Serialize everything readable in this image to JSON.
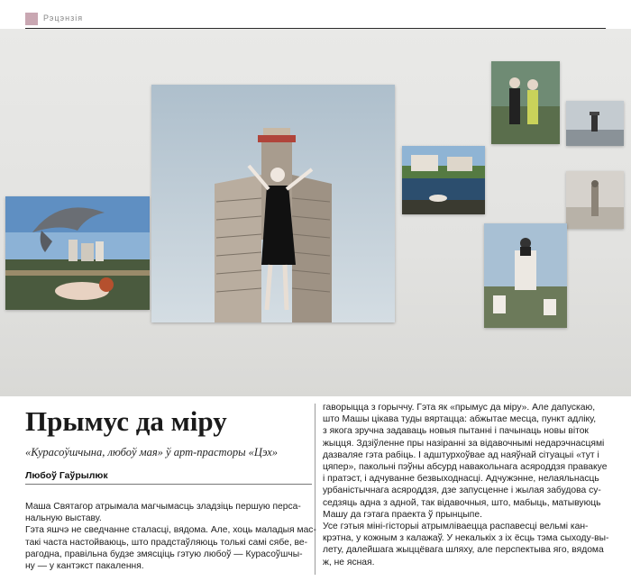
{
  "header": {
    "section_label": "Рэцэнзія"
  },
  "article": {
    "title": "Прымус да міру",
    "subtitle": "«Курасоўшчына, любоў мая» ў арт-прасторы «Цэх»",
    "author": "Любоў Гаўрылюк",
    "left_lines": [
      "Маша Святагор атрымала магчымасць зладзіць першую перса-",
      "нальную выставу.",
      "Гэта яшчэ не сведчанне сталасці, вядома. Але, хоць маладыя мас-",
      "такі часта настойваюць, што прадстаўляюць толькі самі сябе, ве-",
      "рагодна, правільна будзе змясціць гэтую любоў — Курасоўшчы-",
      "ну — у кантэкст пакалення."
    ],
    "right_lines": [
      "гаворыцца з горыччу. Гэта як «прымус да міру». Але дапускаю,",
      "што Машы цікава туды вяртацца: абжытае месца, пункт адліку,",
      "з якога зручна задаваць новыя пытанні і пачынаць новы віток",
      "жыцця. Здзіўленне пры назіранні за відавочнымі недарэчнасцямі",
      "дазваляе гэта рабіць. І адштурхоўвае ад наяўнай сітуацыі «тут і",
      "цяпер», пакольні пэўны абсурд навакольнага асяроддзя правакуе",
      "і пратэст, і адчуванне безвыходнасці. Адчужэнне, нелаяльнасць",
      "урбаністычнага асяроддзя, дзе запусценне і жылая забудова су-",
      "седзяць адна з адной, так відавочныя, што, мабыць, матывуюць",
      "Машу да гэтага праекта ў прынцыпе.",
      "Усе гэтыя міні-гісторыі атрымліваецца распавесці вельмі кан-",
      "крэтна, у кожным з калажаў. У некалькіх з іх ёсць тэма сыходу-вы-",
      "лету, далейшага жыццёвага шляху, але перспектыва яго, вядома",
      "ж, не ясная."
    ]
  }
}
